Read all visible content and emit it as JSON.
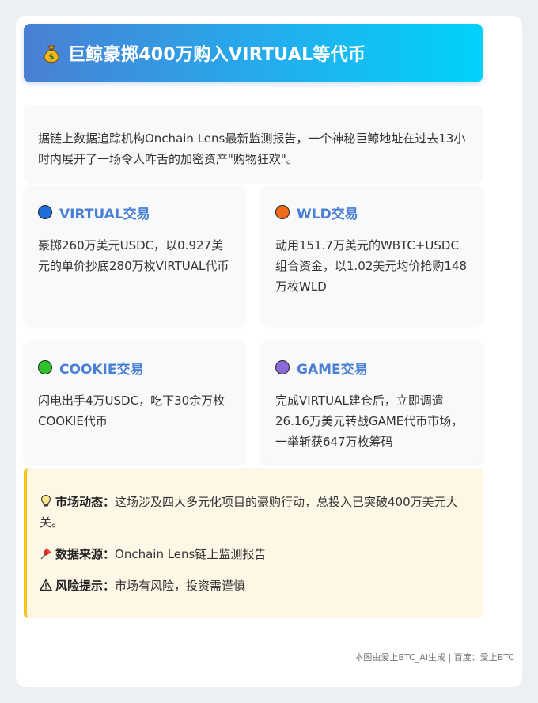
{
  "header": {
    "icon": "money-bag-icon",
    "title": "巨鲸豪掷400万购入VIRTUAL等代币"
  },
  "intro": {
    "text": "据链上数据追踪机构Onchain Lens最新监测报告，一个神秘巨鲸地址在过去13小时内展开了一场令人咋舌的加密资产\"购物狂欢\"。"
  },
  "transactions": [
    {
      "title": "VIRTUAL交易",
      "dot_color": "#1e6fd9",
      "body": "豪掷260万美元USDC，以0.927美元的单价抄底280万枚VIRTUAL代币"
    },
    {
      "title": "WLD交易",
      "dot_color": "#f26b1d",
      "body": "动用151.7万美元的WBTC+USDC组合资金，以1.02美元均价抢购148万枚WLD"
    },
    {
      "title": "COOKIE交易",
      "dot_color": "#2fc22a",
      "body": "闪电出手4万USDC，吃下30余万枚COOKIE代币"
    },
    {
      "title": "GAME交易",
      "dot_color": "#8a6ad6",
      "body": "完成VIRTUAL建仓后，立即调遣26.16万美元转战GAME代币市场，一举斩获647万枚筹码"
    }
  ],
  "notice": {
    "market": {
      "icon": "lightbulb-icon",
      "label": "市场动态：",
      "text": "这场涉及四大多元化项目的豪购行动，总投入已突破400万美元大关。"
    },
    "source": {
      "icon": "pushpin-icon",
      "label": "数据来源：",
      "text": "Onchain Lens链上监测报告"
    },
    "risk": {
      "icon": "warning-icon",
      "label": "风险提示：",
      "text": "市场有风险，投资需谨慎"
    }
  },
  "footer": {
    "text": "本图由爱上BTC_AI生成 | 百度：爱上BTC"
  },
  "colors": {
    "header_gradient_start": "#4a7fd4",
    "header_gradient_end": "#00d2fc",
    "accent_title": "#4a7fd4",
    "notice_bg": "#fef7e6",
    "notice_border": "#f5c518"
  }
}
